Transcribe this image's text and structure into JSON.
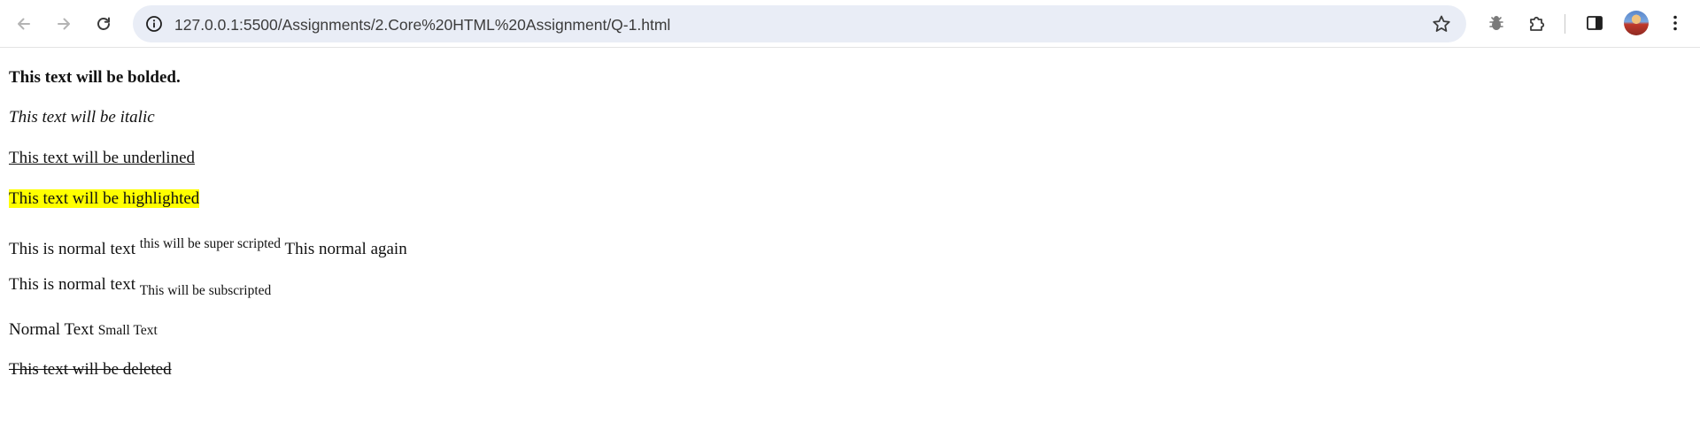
{
  "browser": {
    "url": "127.0.0.1:5500/Assignments/2.Core%20HTML%20Assignment/Q-1.html",
    "icons": {
      "back": "back-arrow-icon",
      "forward": "forward-arrow-icon",
      "reload": "reload-icon",
      "site_info": "info-icon",
      "bookmark": "star-icon",
      "extension_bug": "bug-icon",
      "extensions": "puzzle-icon",
      "side_panel": "side-panel-icon",
      "menu": "kebab-menu-icon"
    }
  },
  "page": {
    "bold_text": "This text will be bolded.",
    "italic_text": "This text will be italic",
    "underline_text": "This text will be underlined",
    "highlight_text": "This text will be highlighted",
    "highlight_color": "#ffff00",
    "sup_line": {
      "normal": "This is normal text",
      "sup": "this will be super scripted",
      "after": "This normal again"
    },
    "sub_line": {
      "normal": "This is normal text",
      "sub": "This will be subscripted"
    },
    "small_line": {
      "normal": "Normal Text",
      "small": "Small Text"
    },
    "deleted_text": "This text will be deleted"
  }
}
